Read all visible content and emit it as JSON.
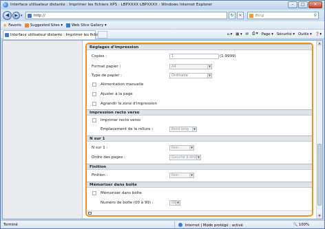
{
  "window": {
    "title": "Interface utilisateur distante : Imprimer les fichiers XPS : LBPXXXX LBPXXXX : Windows Internet Explorer",
    "min_label": "–",
    "max_label": "□",
    "close_label": "✕"
  },
  "address": {
    "url": "http://",
    "search_placeholder": "Bing",
    "back_label": "◀",
    "fwd_label": "▶",
    "drop_label": "▾",
    "search_label": "⚲",
    "refresh_label": "↻",
    "stop_label": "✕"
  },
  "favorites": {
    "favoris_label": "Favoris",
    "suggested_label": "Suggested Sites ▾",
    "webslice_label": "Web Slice Gallery ▾"
  },
  "tabs": {
    "active_tab": "Interface utilisateur distante : Imprimer les fichiers..."
  },
  "commands": {
    "page_label": "Page ▾",
    "security_label": "Sécurité ▾",
    "tools_label": "Outils ▾",
    "help_label": "❓▾",
    "home_label": "⌂ ▾",
    "feeds_label": "▦ ▾",
    "mail_label": "✉",
    "print_label": "⎙ ▾"
  },
  "form": {
    "reglages": {
      "header": "Réglages d'impression",
      "copies_label": "Copies :",
      "copies_value": "1",
      "copies_range": "(1-9999)",
      "format_label": "Format papier :",
      "format_value": "A4",
      "type_label": "Type de papier :",
      "type_value": "Ordinaire",
      "manual_feed_label": "Alimentation manuelle",
      "fit_page_label": "Ajuster à la page",
      "enlarge_label": "Agrandir la zone d'impression"
    },
    "recto_verso": {
      "header": "Impression recto verso",
      "print_rv_label": "Imprimer recto verso",
      "binding_label": "Emplacement de la reliure :",
      "binding_value": "Bord long"
    },
    "n_sur_1": {
      "header": "N sur 1",
      "n_label": "N sur 1 :",
      "n_value": "Non",
      "order_label": "Ordre des pages :",
      "order_value": "Gauche à droite"
    },
    "finition": {
      "header": "Finition",
      "finition_label": "Finition :",
      "finition_value": "Non"
    },
    "memoriser": {
      "header": "Mémoriser dans boîte",
      "memo_label": "Mémoriser dans boîte",
      "box_label": "Numéro de boîte (00 à 99) :",
      "box_value": "00"
    }
  },
  "status": {
    "left": "Terminé",
    "zone": "Internet | Mode protégé : activé",
    "zoom": "100%"
  }
}
